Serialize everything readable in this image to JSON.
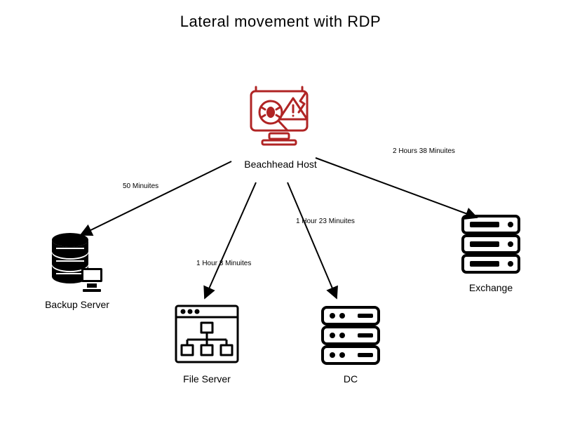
{
  "title": "Lateral movement with RDP",
  "source": {
    "label": "Beachhead Host"
  },
  "targets": {
    "backup": {
      "label": "Backup Server",
      "time": "50 Minuites"
    },
    "file": {
      "label": "File Server",
      "time": "1 Hour 3 Minuites"
    },
    "dc": {
      "label": "DC",
      "time": "1 Hour 23 Minuites"
    },
    "exchange": {
      "label": "Exchange",
      "time": "2 Hours 38 Minuites"
    }
  },
  "colors": {
    "accent": "#B02424",
    "ink": "#000000"
  }
}
